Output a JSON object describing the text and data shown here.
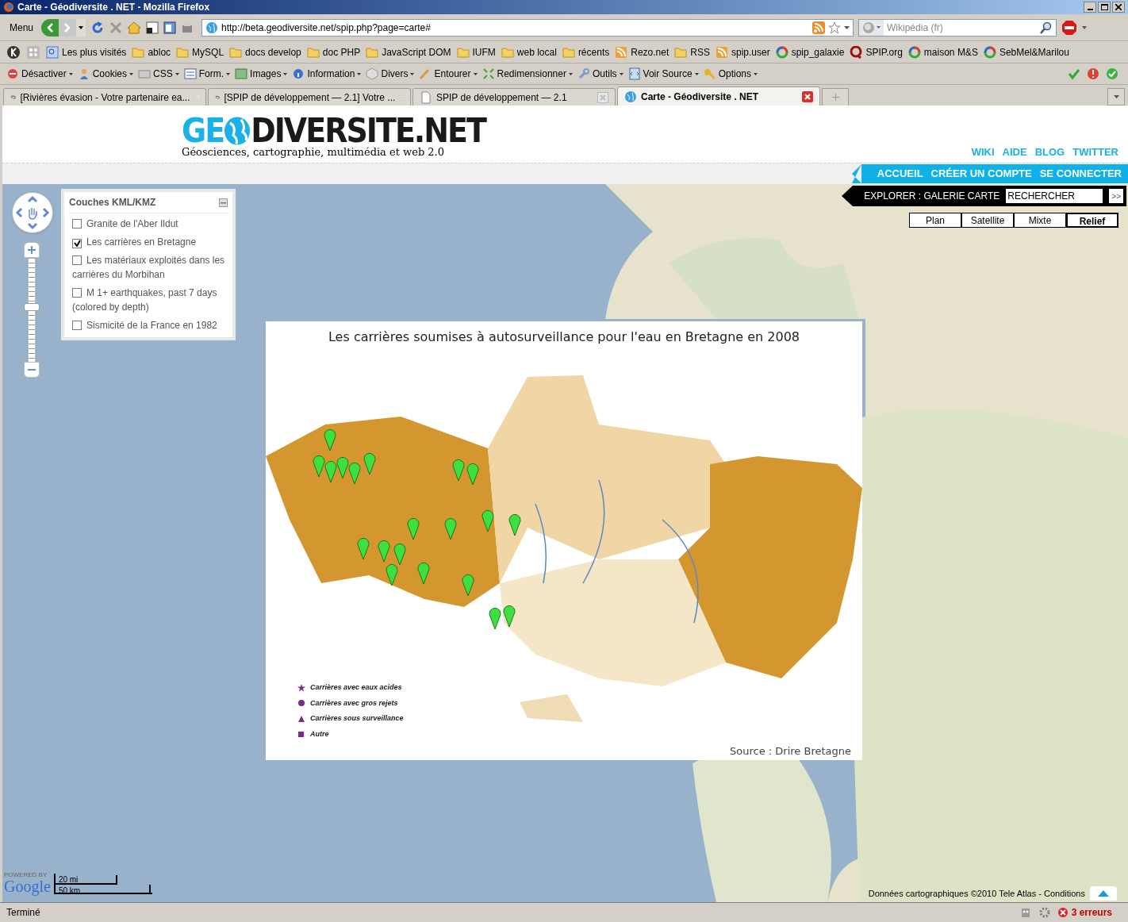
{
  "window": {
    "title": "Carte - Géodiversite . NET - Mozilla Firefox"
  },
  "navbar": {
    "menu": "Menu",
    "url": "http://beta.geodiversite.net/spip.php?page=carte#",
    "search_placeholder": "Wikipédia (fr)"
  },
  "bookmarks": [
    {
      "label": "Les plus visités",
      "kind": "search"
    },
    {
      "label": "abloc",
      "kind": "folder"
    },
    {
      "label": "MySQL",
      "kind": "folder"
    },
    {
      "label": "docs develop",
      "kind": "folder"
    },
    {
      "label": "doc PHP",
      "kind": "folder"
    },
    {
      "label": "JavaScript DOM",
      "kind": "folder"
    },
    {
      "label": "IUFM",
      "kind": "folder"
    },
    {
      "label": "web local",
      "kind": "folder"
    },
    {
      "label": "récents",
      "kind": "folder"
    },
    {
      "label": "Rezo.net",
      "kind": "feed"
    },
    {
      "label": "RSS",
      "kind": "folder"
    },
    {
      "label": "spip.user",
      "kind": "feed"
    },
    {
      "label": "spip_galaxie",
      "kind": "site"
    },
    {
      "label": "SPIP.org",
      "kind": "spip"
    },
    {
      "label": "maison M&S",
      "kind": "site"
    },
    {
      "label": "SebMel&Marilou",
      "kind": "site"
    }
  ],
  "dev_toolbar": [
    "Désactiver",
    "Cookies",
    "CSS",
    "Form.",
    "Images",
    "Information",
    "Divers",
    "Entourer",
    "Redimensionner",
    "Outils",
    "Voir Source",
    "Options"
  ],
  "tabs": [
    {
      "label": "[Rivières évasion - Votre partenaire ea...",
      "selected": false
    },
    {
      "label": "[SPIP de développement — 2.1] Votre ...",
      "selected": false
    },
    {
      "label": "SPIP de développement — 2.1",
      "selected": false
    },
    {
      "label": "Carte - Géodiversite . NET",
      "selected": true
    }
  ],
  "site": {
    "logo_prefix": "GE",
    "logo_suffix": "DIVERSITE.NET",
    "tagline": "Géosciences, cartographie, multimédia et web 2.0",
    "top_links": [
      "WIKI",
      "AIDE",
      "BLOG",
      "TWITTER"
    ],
    "main_nav": [
      "ACCUEIL",
      "CRÉER UN COMPTE",
      "SE CONNECTER"
    ],
    "explore": "EXPLORER : GALERIE CARTE",
    "search_value": "RECHERCHER",
    "search_button": ">>"
  },
  "map": {
    "zoom": {
      "level": 0.53
    },
    "map_types": [
      {
        "label": "Plan",
        "selected": false
      },
      {
        "label": "Satellite",
        "selected": false
      },
      {
        "label": "Mixte",
        "selected": false
      },
      {
        "label": "Relief",
        "selected": true
      }
    ],
    "layers": {
      "title": "Couches KML/KMZ",
      "items": [
        {
          "label": "Granite de l'Aber Ildut",
          "checked": false
        },
        {
          "label": "Les carrières en Bretagne",
          "checked": true
        },
        {
          "label": "Les matériaux exploités dans les carrières du Morbihan",
          "checked": false
        },
        {
          "label": "M 1+ earthquakes, past 7 days (colored by depth)",
          "checked": false
        },
        {
          "label": "Sismicité de la France en 1982",
          "checked": false
        }
      ]
    },
    "overlay": {
      "title": "Les carrières soumises à autosurveillance pour l'eau en Bretagne en 2008",
      "legend": [
        {
          "label": "Carrières avec eaux acides",
          "kind": "star"
        },
        {
          "label": "Carrières avec gros rejets",
          "kind": "circle"
        },
        {
          "label": "Carrières sous surveillance",
          "kind": "triangle"
        },
        {
          "label": "Autre",
          "kind": "square"
        }
      ],
      "source": "Source : Drire Bretagne"
    },
    "powered_by": "POWERED BY",
    "google": "Google",
    "scale": [
      "20 mi",
      "50 km"
    ],
    "attribution": "Données cartographiques ©2010 Tele Atlas - Conditions"
  },
  "status_bar": {
    "text": "Terminé",
    "errors": "3 erreurs"
  }
}
